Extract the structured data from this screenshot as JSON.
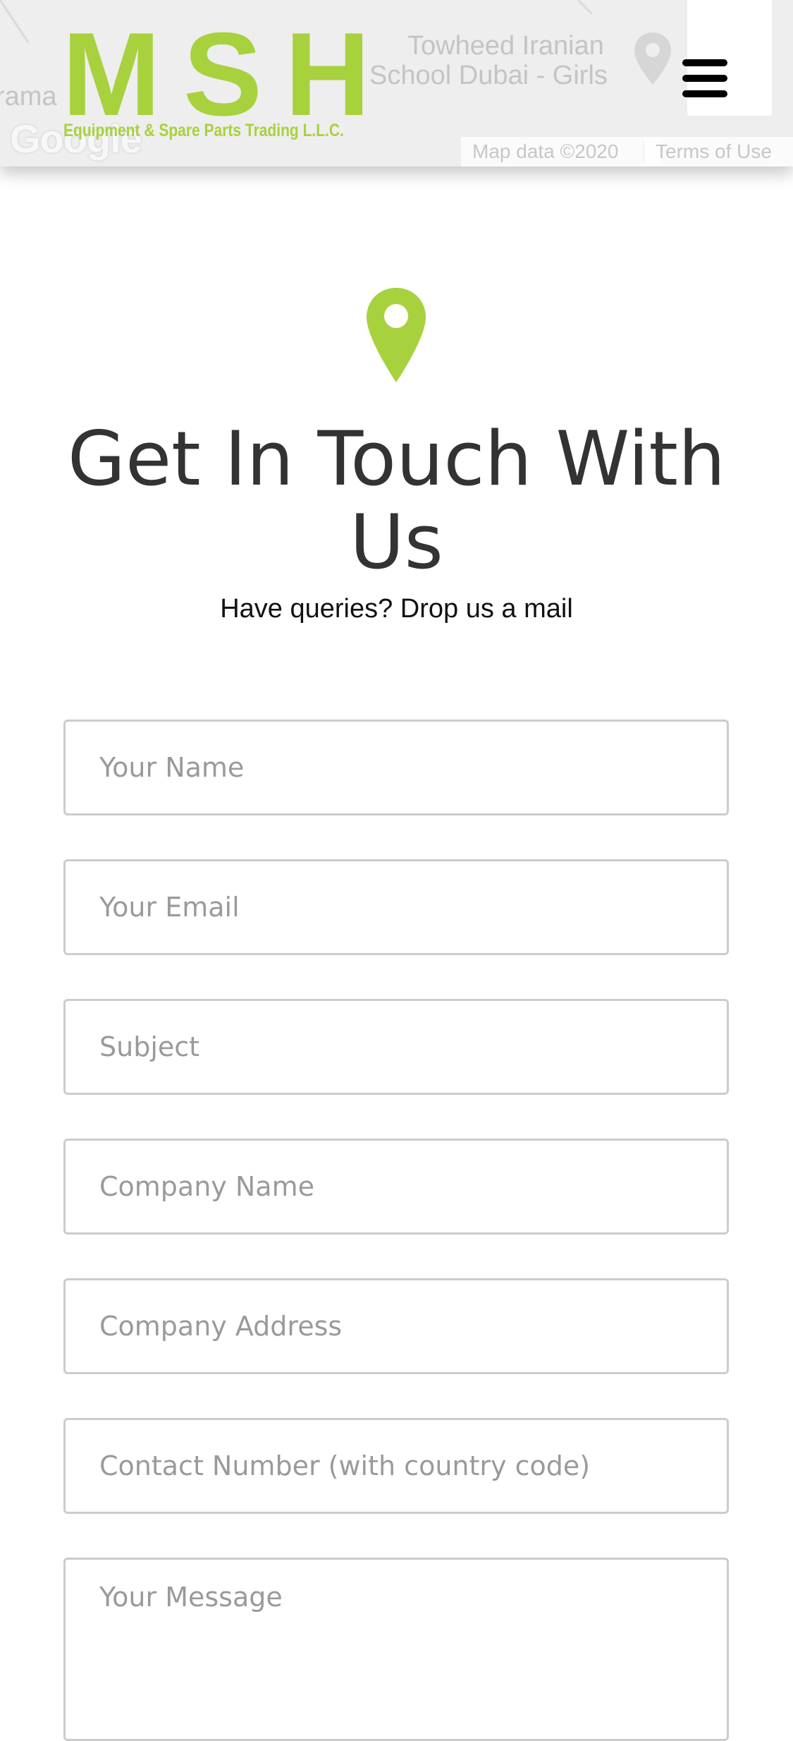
{
  "map": {
    "place_line_1": "Towheed Iranian",
    "place_line_2": "School Dubai - Girls",
    "edge_text": "rama",
    "google_label": "Google",
    "map_data": "Map data ©2020",
    "terms": "Terms of Use"
  },
  "brand": {
    "name": "MSH",
    "tagline": "Equipment & Spare Parts Trading L.L.C.",
    "accent_color": "#a8d13e"
  },
  "nav": {
    "menu_icon": "hamburger-menu-icon"
  },
  "contact": {
    "icon": "location-pin-icon",
    "title": "Get In Touch With Us",
    "subtitle": "Have queries? Drop us a mail"
  },
  "form": {
    "name_placeholder": "Your Name",
    "email_placeholder": "Your Email",
    "subject_placeholder": "Subject",
    "company_placeholder": "Company Name",
    "address_placeholder": "Company Address",
    "phone_placeholder": "Contact Number (with country code)",
    "message_placeholder": "Your Message"
  }
}
